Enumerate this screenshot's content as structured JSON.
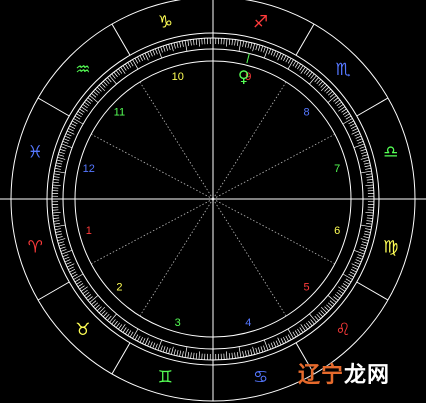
{
  "colors": {
    "background": "#000000",
    "lines": "#ffffff",
    "dotted_lines": "#bbbbbb",
    "fire": "#ff3b3b",
    "earth": "#ffff55",
    "air": "#55ff55",
    "water": "#5577ff"
  },
  "signs": [
    {
      "glyph": "♈",
      "name": "aries",
      "element": "fire"
    },
    {
      "glyph": "♉",
      "name": "taurus",
      "element": "earth"
    },
    {
      "glyph": "♊",
      "name": "gemini",
      "element": "air"
    },
    {
      "glyph": "♋",
      "name": "cancer",
      "element": "water"
    },
    {
      "glyph": "♌",
      "name": "leo",
      "element": "fire"
    },
    {
      "glyph": "♍",
      "name": "virgo",
      "element": "earth"
    },
    {
      "glyph": "♎",
      "name": "libra",
      "element": "air"
    },
    {
      "glyph": "♏",
      "name": "scorpio",
      "element": "water"
    },
    {
      "glyph": "♐",
      "name": "sagittarius",
      "element": "fire"
    },
    {
      "glyph": "♑",
      "name": "capricorn",
      "element": "earth"
    },
    {
      "glyph": "♒",
      "name": "aquarius",
      "element": "air"
    },
    {
      "glyph": "♓",
      "name": "pisces",
      "element": "water"
    }
  ],
  "houses": [
    {
      "label": "1",
      "element": "fire"
    },
    {
      "label": "2",
      "element": "earth"
    },
    {
      "label": "3",
      "element": "air"
    },
    {
      "label": "4",
      "element": "water"
    },
    {
      "label": "5",
      "element": "fire"
    },
    {
      "label": "6",
      "element": "earth"
    },
    {
      "label": "7",
      "element": "air"
    },
    {
      "label": "8",
      "element": "water"
    },
    {
      "label": "9",
      "element": "fire"
    },
    {
      "label": "10",
      "element": "earth"
    },
    {
      "label": "11",
      "element": "air"
    },
    {
      "label": "12",
      "element": "water"
    }
  ],
  "planets": [
    {
      "glyph": "♀",
      "name": "venus",
      "element": "air"
    }
  ],
  "watermark": {
    "part1": "辽宁",
    "part2": "龙网"
  }
}
